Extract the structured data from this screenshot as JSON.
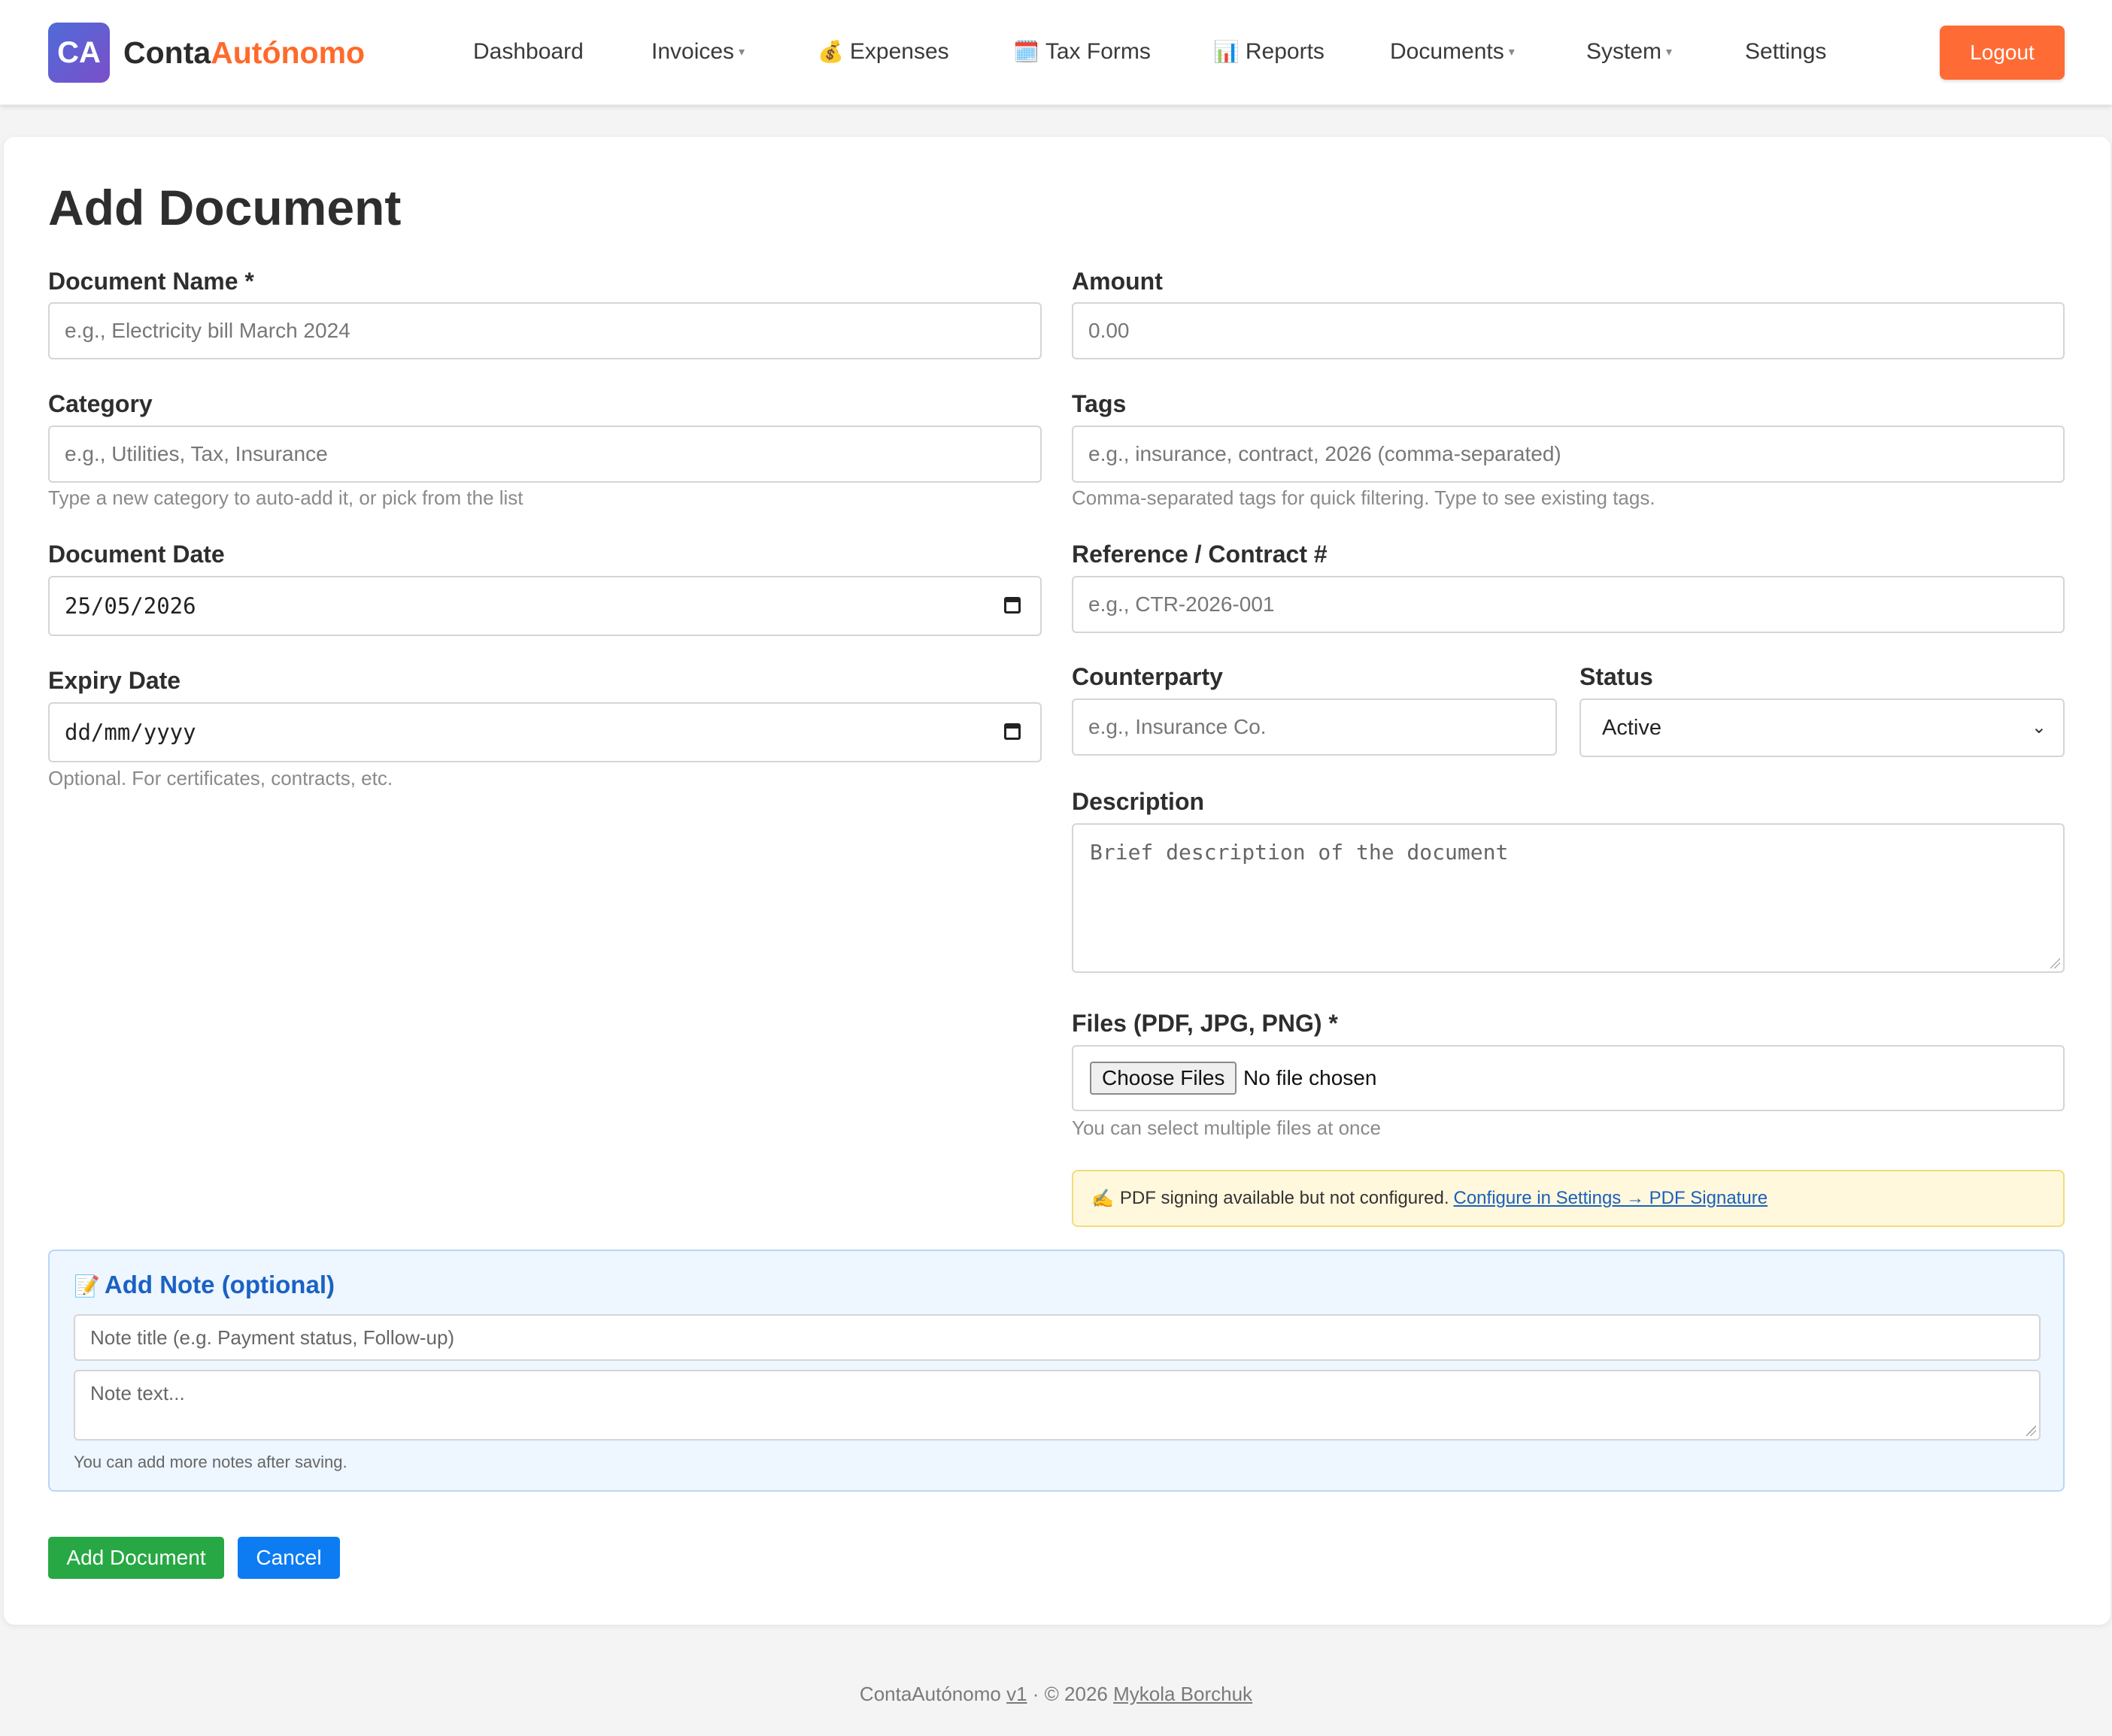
{
  "nav": {
    "logo_text": "CA",
    "brand_part1": "Conta",
    "brand_part2": "Autónomo",
    "items": [
      {
        "label": "Dashboard",
        "icon": "",
        "dropdown": false
      },
      {
        "label": "Invoices",
        "icon": "",
        "dropdown": true
      },
      {
        "label": "Expenses",
        "icon": "💰",
        "dropdown": false
      },
      {
        "label": "Tax Forms",
        "icon": "🗓️",
        "dropdown": false
      },
      {
        "label": "Reports",
        "icon": "📊",
        "dropdown": false
      },
      {
        "label": "Documents",
        "icon": "",
        "dropdown": true
      },
      {
        "label": "System",
        "icon": "",
        "dropdown": true
      },
      {
        "label": "Settings",
        "icon": "",
        "dropdown": false
      }
    ],
    "logout_label": "Logout"
  },
  "form": {
    "title": "Add Document",
    "document_name": {
      "label": "Document Name *",
      "placeholder": "e.g., Electricity bill March 2024"
    },
    "amount": {
      "label": "Amount",
      "placeholder": "0.00"
    },
    "category": {
      "label": "Category",
      "placeholder": "e.g., Utilities, Tax, Insurance",
      "hint": "Type a new category to auto-add it, or pick from the list"
    },
    "tags": {
      "label": "Tags",
      "placeholder": "e.g., insurance, contract, 2026 (comma-separated)",
      "hint": "Comma-separated tags for quick filtering. Type to see existing tags."
    },
    "document_date": {
      "label": "Document Date",
      "value": "25/05/2026"
    },
    "reference": {
      "label": "Reference / Contract #",
      "placeholder": "e.g., CTR-2026-001"
    },
    "expiry_date": {
      "label": "Expiry Date",
      "value": "dd/mm/yyyy",
      "hint": "Optional. For certificates, contracts, etc."
    },
    "counterparty": {
      "label": "Counterparty",
      "placeholder": "e.g., Insurance Co."
    },
    "status": {
      "label": "Status",
      "value": "Active"
    },
    "description": {
      "label": "Description",
      "placeholder": "Brief description of the document"
    },
    "files": {
      "label": "Files (PDF, JPG, PNG) *",
      "button": "Choose Files",
      "status": "No file chosen",
      "hint": "You can select multiple files at once"
    },
    "pdf_alert": {
      "icon": "✍️",
      "text": "PDF signing available but not configured.",
      "link": "Configure in Settings → PDF Signature"
    },
    "note": {
      "icon": "📝",
      "title": "Add Note (optional)",
      "title_placeholder": "Note title (e.g. Payment status, Follow-up)",
      "text_placeholder": "Note text...",
      "hint": "You can add more notes after saving."
    },
    "submit_label": "Add Document",
    "cancel_label": "Cancel"
  },
  "footer": {
    "app": "ContaAutónomo",
    "version": "v1",
    "sep": " · © 2026 ",
    "author": "Mykola Borchuk"
  },
  "colors": {
    "accent_orange": "#ff6b35",
    "green": "#27a844",
    "blue": "#0d7cf2"
  }
}
